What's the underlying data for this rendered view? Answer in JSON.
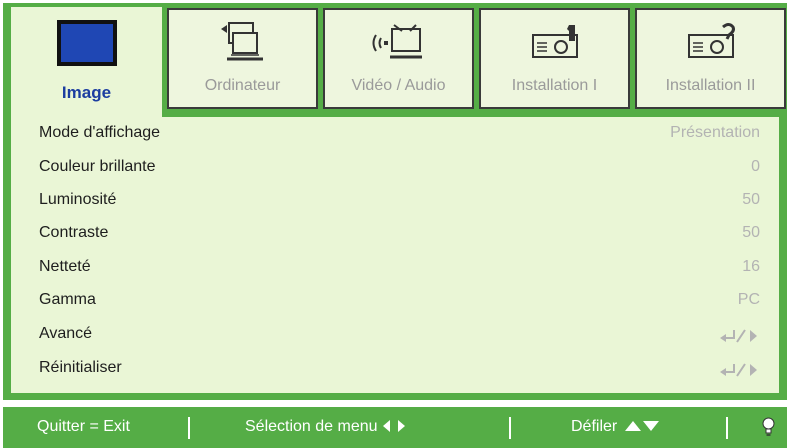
{
  "tabs": [
    {
      "label": "Image",
      "icon": "monitor-icon",
      "active": true
    },
    {
      "label": "Ordinateur",
      "icon": "computer-icon",
      "active": false
    },
    {
      "label": "Vidéo / Audio",
      "icon": "video-audio-icon",
      "active": false
    },
    {
      "label": "Installation I",
      "icon": "projector-1-icon",
      "active": false
    },
    {
      "label": "Installation II",
      "icon": "projector-2-icon",
      "active": false
    }
  ],
  "menu": [
    {
      "label": "Mode d'affichage",
      "value": "Présentation"
    },
    {
      "label": "Couleur brillante",
      "value": "0"
    },
    {
      "label": "Luminosité",
      "value": "50"
    },
    {
      "label": "Contraste",
      "value": "50"
    },
    {
      "label": "Netteté",
      "value": "16"
    },
    {
      "label": "Gamma",
      "value": "PC"
    },
    {
      "label": "Avancé",
      "value_icon": "enter-right-arrow-icon"
    },
    {
      "label": "Réinitialiser",
      "value_icon": "enter-right-arrow-icon"
    }
  ],
  "footer": {
    "quit": "Quitter = Exit",
    "select": "Sélection de menu",
    "scroll": "Défiler",
    "icon": "lightbulb-icon"
  },
  "colors": {
    "accent_green": "#55ad46",
    "panel": "#eaf6d6",
    "active_tab_text": "#1b3da0",
    "value_text": "#b3b3b3"
  }
}
